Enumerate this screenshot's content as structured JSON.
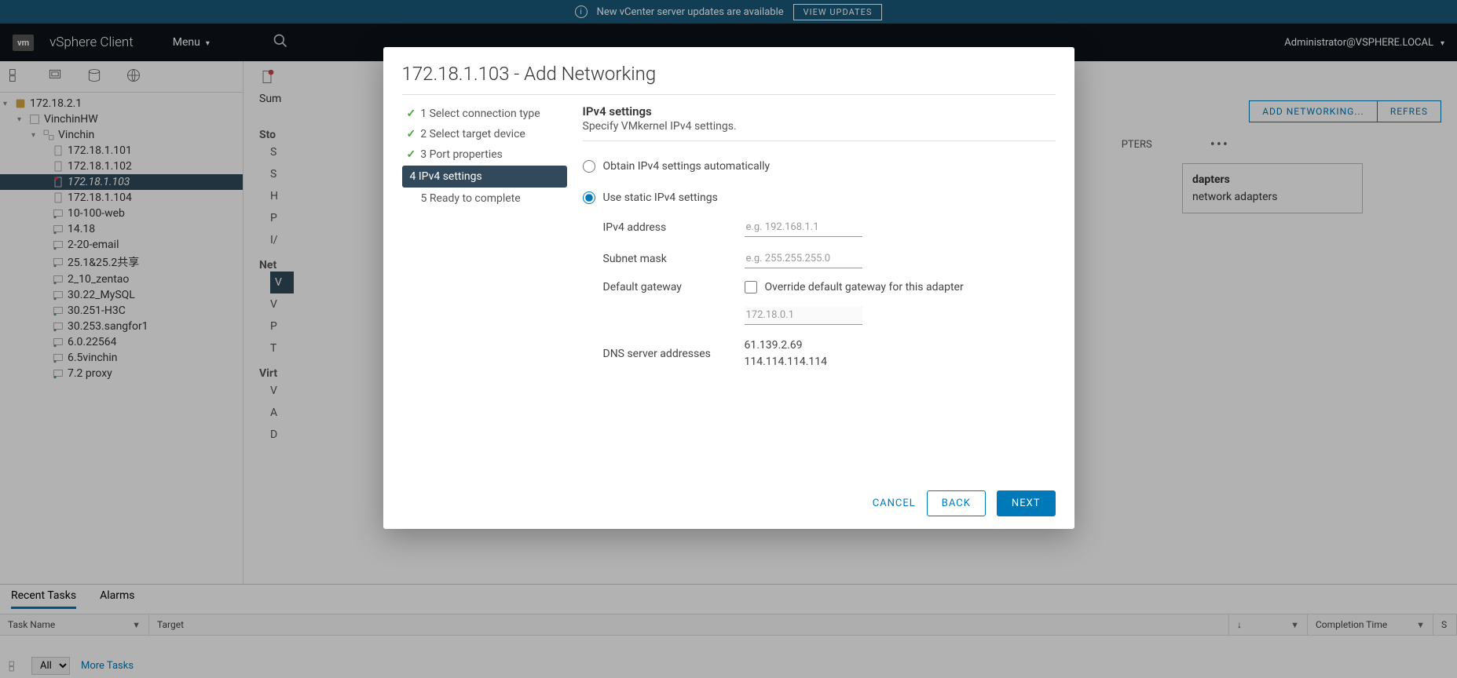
{
  "banner": {
    "text": "New vCenter server updates are available",
    "button": "VIEW UPDATES"
  },
  "header": {
    "app": "vSphere Client",
    "menu": "Menu",
    "user": "Administrator@VSPHERE.LOCAL"
  },
  "tree": {
    "root": "172.18.2.1",
    "dc": "VinchinHW",
    "cluster": "Vinchin",
    "hosts": [
      "172.18.1.101",
      "172.18.1.102",
      "172.18.1.103",
      "172.18.1.104"
    ],
    "selected": "172.18.1.103",
    "vms": [
      "10-100-web",
      "14.18",
      "2-20-email",
      "25.1&25.2共享",
      "2_10_zentao",
      "30.22_MySQL",
      "30.251-H3C",
      "30.253.sangfor1",
      "6.0.22564",
      "6.5vinchin",
      "7.2 proxy"
    ]
  },
  "content": {
    "summary": "Sum",
    "sections": {
      "storage": "Sto",
      "net": "Net",
      "virt": "Virt"
    },
    "items_s": [
      "S",
      "S",
      "H",
      "P",
      "I/"
    ],
    "items_n": [
      "V",
      "V",
      "P",
      "T"
    ],
    "items_v": [
      "V",
      "A",
      "D"
    ],
    "add_net": "ADD NETWORKING...",
    "refresh": "REFRES",
    "adapters_tab": "PTERS",
    "panel_title": "dapters",
    "panel_text": "network adapters"
  },
  "modal": {
    "title": "172.18.1.103 - Add Networking",
    "steps": [
      "1 Select connection type",
      "2 Select target device",
      "3 Port properties",
      "4 IPv4 settings",
      "5 Ready to complete"
    ],
    "active_step": 3,
    "panel": {
      "title": "IPv4 settings",
      "subtitle": "Specify VMkernel IPv4 settings.",
      "radio_auto": "Obtain IPv4 settings automatically",
      "radio_static": "Use static IPv4 settings",
      "labels": {
        "ipv4": "IPv4 address",
        "mask": "Subnet mask",
        "gateway": "Default gateway",
        "dns": "DNS server addresses"
      },
      "placeholders": {
        "ipv4": "e.g. 192.168.1.1",
        "mask": "e.g. 255.255.255.0"
      },
      "override": "Override default gateway for this adapter",
      "gateway_value": "172.18.0.1",
      "dns": [
        "61.139.2.69",
        "114.114.114.114"
      ]
    },
    "buttons": {
      "cancel": "CANCEL",
      "back": "BACK",
      "next": "NEXT"
    }
  },
  "tasks": {
    "tabs": [
      "Recent Tasks",
      "Alarms"
    ],
    "cols": {
      "name": "Task Name",
      "target": "Target",
      "completion": "Completion Time",
      "s": "S"
    },
    "filter": "All",
    "more": "More Tasks"
  }
}
